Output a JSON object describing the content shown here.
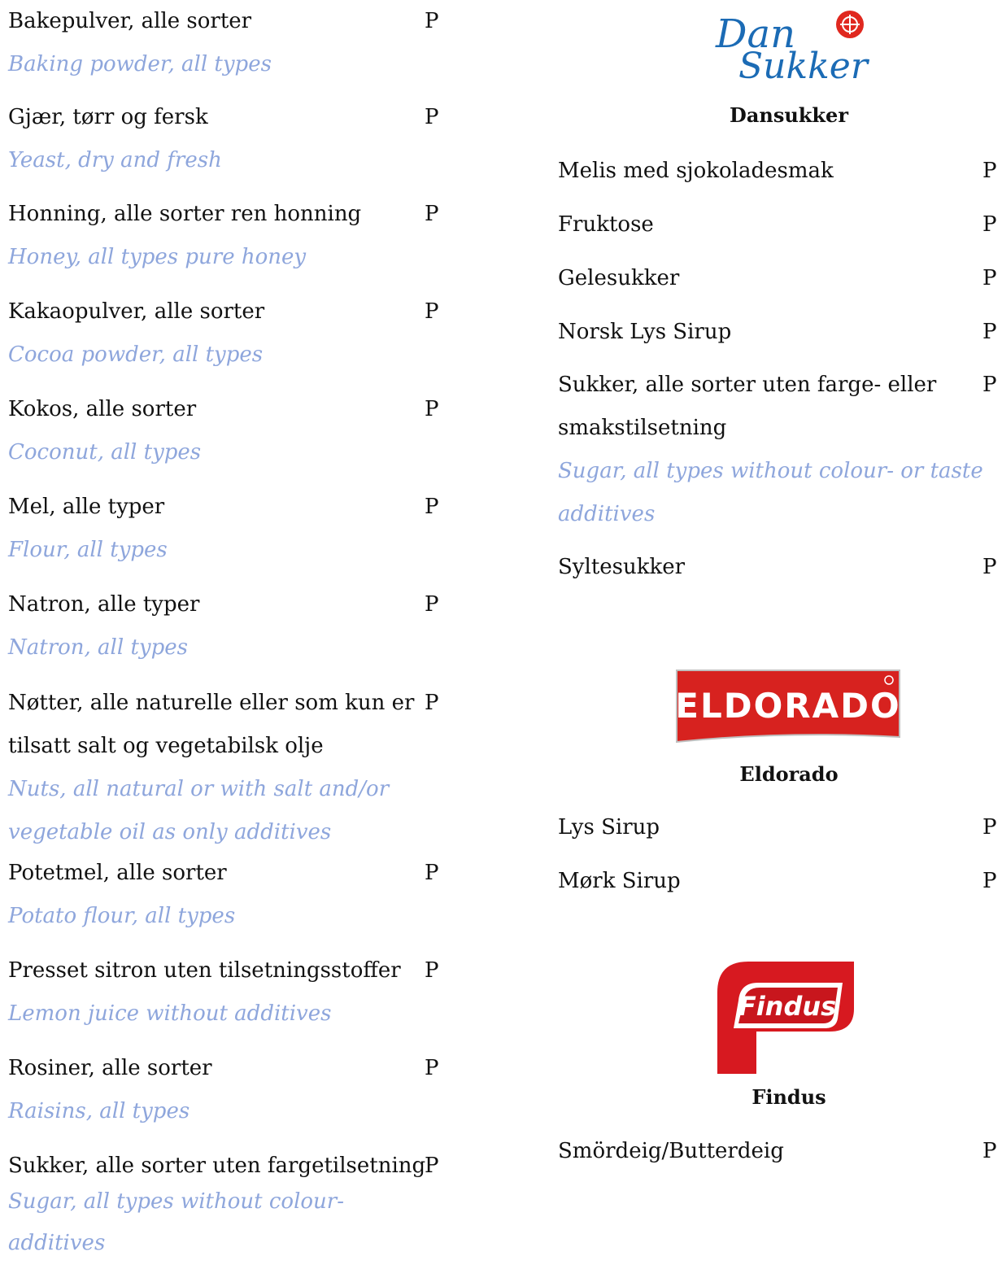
{
  "left_items": [
    {
      "no": "Bakepulver, alle sorter",
      "en": "Baking powder, all types",
      "mark": "P"
    },
    {
      "no": "Gjær, tørr og fersk",
      "en": "Yeast, dry and fresh",
      "mark": "P"
    },
    {
      "no": "Honning, alle sorter ren honning",
      "en": "Honey, all types pure honey",
      "mark": "P"
    },
    {
      "no": "Kakaopulver, alle sorter",
      "en": "Cocoa powder, all types",
      "mark": "P"
    },
    {
      "no": "Kokos, alle sorter",
      "en": "Coconut, all types",
      "mark": "P"
    },
    {
      "no": "Mel, alle typer",
      "en": "Flour, all types",
      "mark": "P"
    },
    {
      "no": "Natron, alle typer",
      "en": "Natron, all types",
      "mark": "P"
    },
    {
      "no1": "Nøtter, alle naturelle eller som kun er",
      "no2": "tilsatt salt og vegetabilsk olje",
      "en1": "Nuts, all natural or with salt and/or",
      "en2": "vegetable oil as only additives",
      "mark": "P"
    },
    {
      "no": "Potetmel, alle sorter",
      "en": "Potato flour, all types",
      "mark": "P"
    },
    {
      "no": "Presset sitron uten tilsetningsstoffer",
      "en": "Lemon juice without additives",
      "mark": "P"
    },
    {
      "no": "Rosiner, alle sorter",
      "en": "Raisins, all types",
      "mark": "P"
    },
    {
      "no": "Sukker, alle sorter uten fargetilsetning",
      "en1": "Sugar, all types without colour-",
      "en2": "additives",
      "mark": "P"
    }
  ],
  "brands": {
    "dansukker": {
      "logo_text_1": "Dan",
      "logo_text_2": "Sukker",
      "name": "Dansukker",
      "items": [
        {
          "no": "Melis med sjokoladesmak",
          "mark": "P"
        },
        {
          "no": "Fruktose",
          "mark": "P"
        },
        {
          "no": "Gelesukker",
          "mark": "P"
        },
        {
          "no": "Norsk Lys Sirup",
          "mark": "P"
        },
        {
          "no1": "Sukker, alle sorter uten farge- eller",
          "no2": "smakstilsetning",
          "en1": "Sugar, all types without colour- or taste",
          "en2": "additives",
          "mark": "P"
        },
        {
          "no": "Syltesukker",
          "mark": "P"
        }
      ]
    },
    "eldorado": {
      "logo_text": "ELDORADO",
      "name": "Eldorado",
      "items": [
        {
          "no": "Lys Sirup",
          "mark": "P"
        },
        {
          "no": "Mørk Sirup",
          "mark": "P"
        }
      ]
    },
    "findus": {
      "logo_text": "Findus",
      "name": "Findus",
      "items": [
        {
          "no": "Smördeig/Butterdeig",
          "mark": "P"
        }
      ]
    }
  },
  "colors": {
    "english_text": "#8ea6dc",
    "dansukker_blue": "#1b6bb5",
    "eldorado_red": "#d7221f",
    "findus_red": "#d71920"
  }
}
